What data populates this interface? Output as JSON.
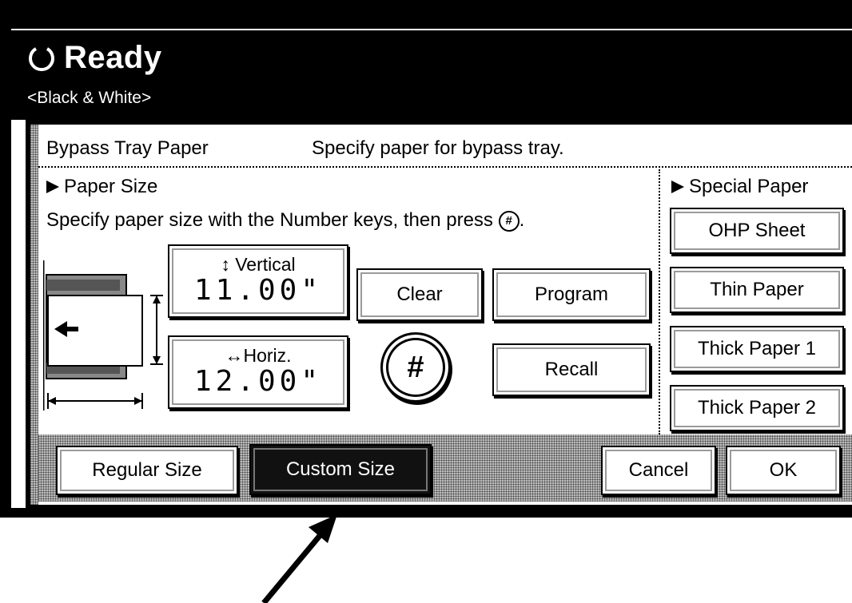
{
  "header": {
    "status": "Ready",
    "color_mode": "<Black & White>"
  },
  "dialog": {
    "title": "Bypass Tray Paper",
    "hint": "Specify paper for bypass tray."
  },
  "paper_size": {
    "heading": "Paper Size",
    "instruction": "Specify paper size with the Number keys, then press",
    "vertical": {
      "label": "↕ Vertical",
      "value": "11.00\""
    },
    "horizontal": {
      "label": "↔Horiz.",
      "value": "12.00\""
    },
    "clear_label": "Clear",
    "program_label": "Program",
    "recall_label": "Recall",
    "hash_symbol": "#"
  },
  "special_paper": {
    "heading": "Special Paper",
    "options": [
      "OHP Sheet",
      "Thin Paper",
      "Thick Paper 1",
      "Thick Paper 2"
    ]
  },
  "footer": {
    "regular_label": "Regular Size",
    "custom_label": "Custom Size",
    "cancel_label": "Cancel",
    "ok_label": "OK"
  },
  "icons": {
    "status": "busy-circle-icon",
    "section_marker": "triangle-right-icon",
    "hash": "hash-key-icon",
    "paper_feed": "paper-feed-diagram",
    "callout": "callout-arrow"
  },
  "colors": {
    "screen_dark": "#000000",
    "screen_light": "#ffffff",
    "selected_button": "#111111"
  }
}
